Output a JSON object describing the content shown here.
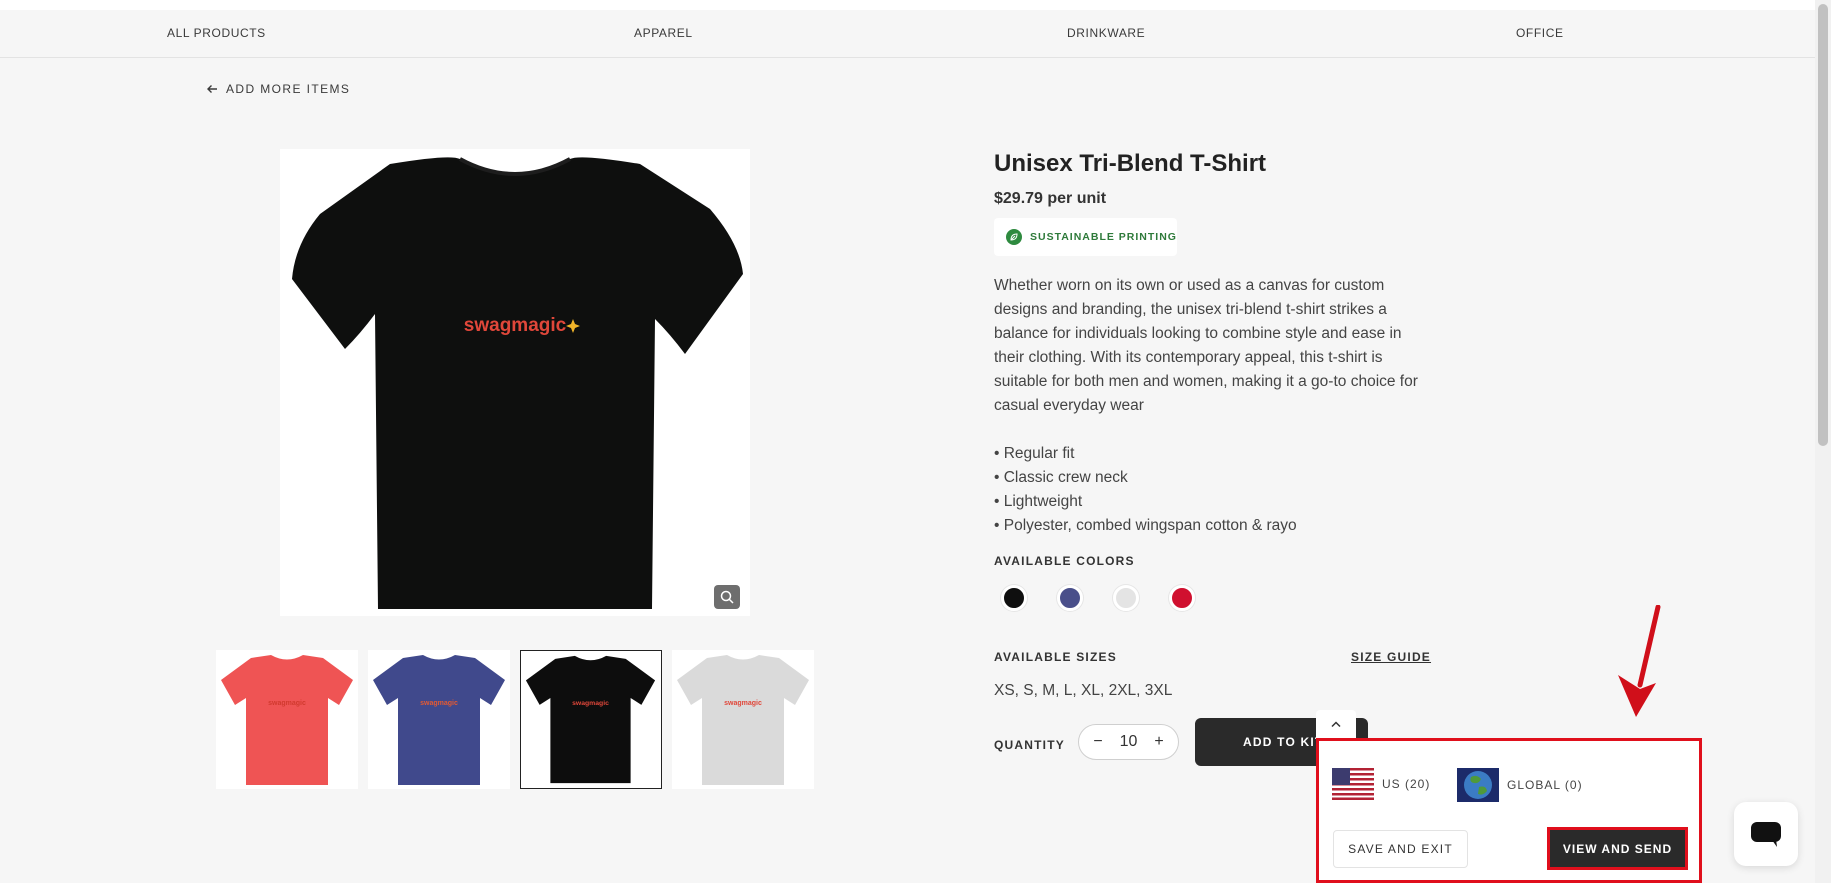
{
  "nav": {
    "items": [
      {
        "label": "ALL PRODUCTS"
      },
      {
        "label": "APPAREL"
      },
      {
        "label": "DRINKWARE"
      },
      {
        "label": "OFFICE"
      }
    ]
  },
  "back_link": {
    "label": "ADD MORE ITEMS",
    "icon": "arrow-left-icon"
  },
  "product": {
    "title": "Unisex Tri-Blend T-Shirt",
    "price": "$29.79 per unit",
    "badge": {
      "label": "SUSTAINABLE PRINTING",
      "icon": "leaf-icon",
      "color": "#2e8a3f"
    },
    "description": "Whether worn on its own or used as a canvas for custom designs and branding, the unisex tri-blend t-shirt strikes a balance for individuals looking to combine style and ease in their clothing. With its contemporary appeal, this t-shirt is suitable for both men and women, making it a go-to choice for casual everyday wear",
    "features": [
      "• Regular fit",
      "• Classic crew neck",
      "• Lightweight",
      "• Polyester, combed wingspan cotton & rayo"
    ],
    "logo_text": "swagmagic",
    "colors_label": "AVAILABLE COLORS",
    "colors": [
      {
        "name": "black",
        "hex": "#0f0f0f"
      },
      {
        "name": "navy",
        "hex": "#4a4f8a"
      },
      {
        "name": "heather-grey",
        "hex": "#e4e4e4"
      },
      {
        "name": "red",
        "hex": "#d0102f"
      }
    ],
    "sizes_label": "AVAILABLE SIZES",
    "size_guide_label": "SIZE GUIDE",
    "sizes": "XS, S, M, L, XL, 2XL, 3XL",
    "quantity_label": "QUANTITY",
    "quantity": "10",
    "minus": "−",
    "plus": "+",
    "add_to_kit_label": "ADD TO KIT",
    "thumbnails": [
      {
        "name": "red-shirt",
        "color": "#ef5454"
      },
      {
        "name": "navy-shirt",
        "color": "#40498c"
      },
      {
        "name": "black-shirt",
        "color": "#0d0d0d",
        "selected": true
      },
      {
        "name": "grey-shirt",
        "color": "#dadada"
      }
    ]
  },
  "kit_panel": {
    "us_label": "US (20)",
    "global_label": "GLOBAL (0)",
    "save_exit_label": "SAVE AND EXIT",
    "view_send_label": "VIEW AND SEND",
    "highlight_color": "#e00f1c"
  }
}
